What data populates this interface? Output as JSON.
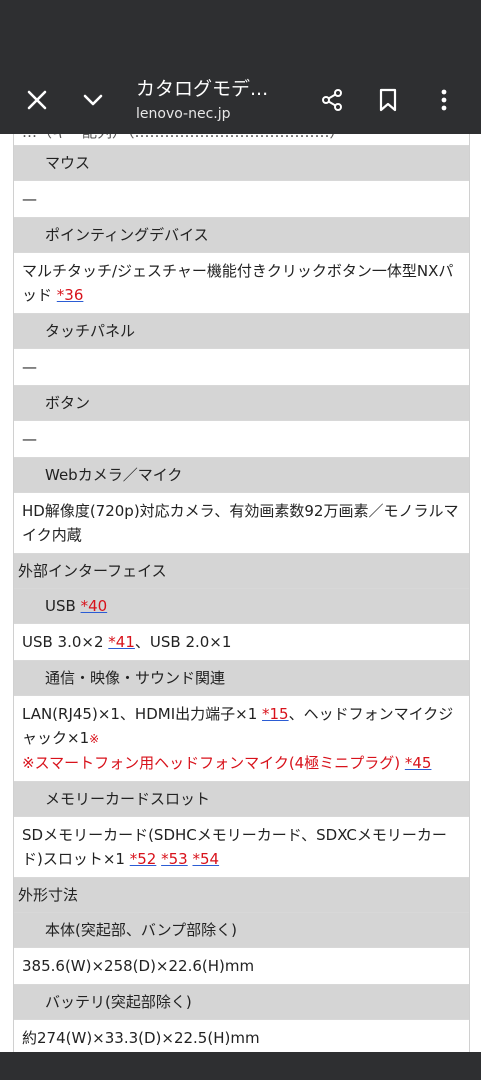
{
  "toolbar": {
    "title": "カタログモデ...",
    "url": "lenovo-nec.jp",
    "close_icon": "close-icon",
    "collapse_icon": "chevron-down-icon",
    "share_icon": "share-icon",
    "bookmark_icon": "bookmark-icon",
    "more_icon": "more-vert-icon"
  },
  "spec": {
    "cut_row": "…（キー配列）（…………………………………）",
    "mouse_label": "マウス",
    "mouse_value": "—",
    "pointing_label": "ポインティングデバイス",
    "pointing_value": "マルチタッチ/ジェスチャー機能付きクリックボタン一体型NXパッド ",
    "pointing_ref": "*36",
    "touch_label": "タッチパネル",
    "touch_value": "—",
    "button_label": "ボタン",
    "button_value": "—",
    "webcam_label": "Webカメラ／マイク",
    "webcam_value": "HD解像度(720p)対応カメラ、有効画素数92万画素／モノラルマイク内蔵",
    "ext_category": "外部インターフェイス",
    "usb_label": "USB ",
    "usb_ref": "*40",
    "usb_value_a": "USB 3.0×2 ",
    "usb_value_ref": "*41",
    "usb_value_b": "、USB 2.0×1",
    "comm_label": "通信・映像・サウンド関連",
    "comm_value_a": "LAN(RJ45)×1、HDMI出力端子×1 ",
    "comm_ref1": "*15",
    "comm_value_b": "、ヘッドフォンマイクジャック×1",
    "comm_note_mark": "※",
    "comm_note_text": "※スマートフォン用ヘッドフォンマイク(4極ミニプラグ) ",
    "comm_ref2": "*45",
    "memcard_label": "メモリーカードスロット",
    "memcard_value": "SDメモリーカード(SDHCメモリーカード、SDXCメモリーカード)スロット×1 ",
    "memcard_ref1": "*52",
    "memcard_ref2": "*53",
    "memcard_ref3": "*54",
    "dim_category": "外形寸法",
    "body_label": "本体(突起部、バンプ部除く)",
    "body_value": "385.6(W)×258(D)×22.6(H)mm",
    "battery_label": "バッテリ(突起部除く)",
    "battery_value": "約274(W)×33.3(D)×22.5(H)mm"
  }
}
